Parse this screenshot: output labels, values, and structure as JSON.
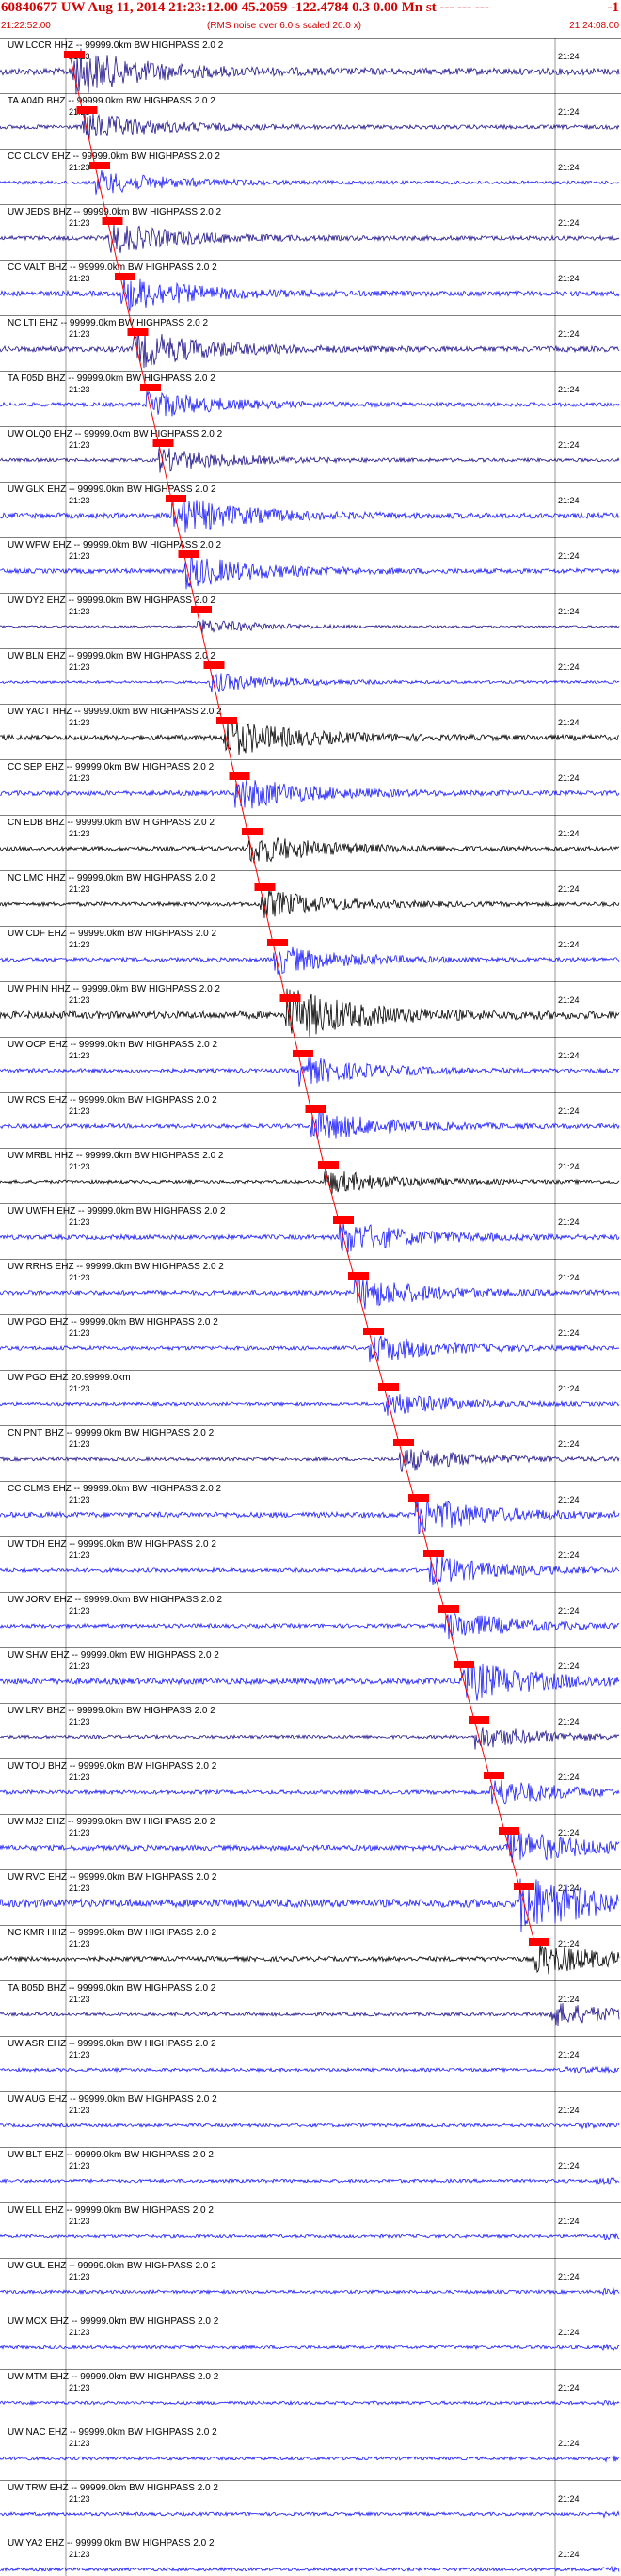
{
  "header": {
    "title": "60840677 UW Aug 11, 2014 21:23:12.00   45.2059  -122.4784  0.3 0.00 Mn st --- --- ---",
    "right_mark": "-1",
    "start_time": "21:22:52.00",
    "end_time": "21:24:08.00",
    "note": "(RMS noise over 6.0 s scaled 20.0 x)"
  },
  "chart_data": {
    "type": "line",
    "title": "60840677 UW Aug 11, 2014 21:23:12.00   45.2059  -122.4784  0.3 0.00 Mn st --- --- ---",
    "x_range": [
      "21:22:52.00",
      "21:24:08.00"
    ],
    "minute_ticks": [
      "21:23",
      "21:24"
    ],
    "colors": {
      "header": "#d40000",
      "pick": "#ff0000",
      "grid": "#000000"
    },
    "traces": [
      {
        "label": "UW LCCR HHZ -- 99999.0km BW  HIGHPASS  2.0  2",
        "color": "#20148c",
        "amp": 2.0
      },
      {
        "label": "TA A04D BHZ -- 99999.0km BW  HIGHPASS  2.0  2",
        "color": "#20148c",
        "amp": 1.2
      },
      {
        "label": "CC CLCV EHZ -- 99999.0km BW  HIGHPASS  2.0  2",
        "color": "#1a1aff",
        "amp": 1.0
      },
      {
        "label": "UW JEDS BHZ -- 99999.0km BW  HIGHPASS  2.0  2",
        "color": "#20148c",
        "amp": 1.3
      },
      {
        "label": "CC VALT BHZ -- 99999.0km BW  HIGHPASS  2.0  2",
        "color": "#1a1aff",
        "amp": 1.5
      },
      {
        "label": "NC LTI EHZ -- 99999.0km BW  HIGHPASS  2.0  2",
        "color": "#20148c",
        "amp": 1.6
      },
      {
        "label": "TA F05D BHZ -- 99999.0km BW  HIGHPASS  2.0  2",
        "color": "#1a1aff",
        "amp": 1.2
      },
      {
        "label": "UW OLQ0 EHZ -- 99999.0km BW  HIGHPASS  2.0  2",
        "color": "#20148c",
        "amp": 1.0
      },
      {
        "label": "UW GLK EHZ -- 99999.0km BW  HIGHPASS  2.0  2",
        "color": "#1a1aff",
        "amp": 1.6
      },
      {
        "label": "UW WPW EHZ -- 99999.0km BW  HIGHPASS  2.0  2",
        "color": "#1a1aff",
        "amp": 1.4
      },
      {
        "label": "UW DY2 EHZ -- 99999.0km BW  HIGHPASS  2.0  2",
        "color": "#20148c",
        "amp": 0.6
      },
      {
        "label": "UW BLN EHZ -- 99999.0km BW  HIGHPASS  2.0  2",
        "color": "#1a1aff",
        "amp": 0.8
      },
      {
        "label": "UW YACT HHZ -- 99999.0km BW  HIGHPASS  2.0  2",
        "color": "#000000",
        "amp": 1.6
      },
      {
        "label": "CC SEP EHZ -- 99999.0km BW  HIGHPASS  2.0  2",
        "color": "#1a1aff",
        "amp": 1.4
      },
      {
        "label": "CN EDB BHZ -- 99999.0km BW  HIGHPASS  2.0  2",
        "color": "#000000",
        "amp": 1.3
      },
      {
        "label": "NC LMC HHZ -- 99999.0km BW  HIGHPASS  2.0  2",
        "color": "#000000",
        "amp": 1.2
      },
      {
        "label": "UW CDF EHZ -- 99999.0km BW  HIGHPASS  2.0  2",
        "color": "#1a1aff",
        "amp": 1.2
      },
      {
        "label": "UW PHIN HHZ -- 99999.0km BW  HIGHPASS  2.0  2",
        "color": "#000000",
        "amp": 2.2
      },
      {
        "label": "UW OCP EHZ -- 99999.0km BW  HIGHPASS  2.0  2",
        "color": "#1a1aff",
        "amp": 1.2
      },
      {
        "label": "UW RCS EHZ -- 99999.0km BW  HIGHPASS  2.0  2",
        "color": "#1a1aff",
        "amp": 1.3
      },
      {
        "label": "UW MRBL HHZ -- 99999.0km BW  HIGHPASS  2.0  2",
        "color": "#000000",
        "amp": 1.0
      },
      {
        "label": "UW UWFH EHZ -- 99999.0km BW  HIGHPASS  2.0  2",
        "color": "#1a1aff",
        "amp": 1.4
      },
      {
        "label": "UW RRHS EHZ -- 99999.0km BW  HIGHPASS  2.0  2",
        "color": "#1a1aff",
        "amp": 1.4
      },
      {
        "label": "UW PGO EHZ -- 99999.0km BW  HIGHPASS  2.0  2",
        "color": "#1a1aff",
        "amp": 1.2
      },
      {
        "label": "UW PGO EHZ 20.99999.0km",
        "color": "#1a1aff",
        "amp": 1.0
      },
      {
        "label": "CN PNT BHZ -- 99999.0km BW  HIGHPASS  2.0  2",
        "color": "#20148c",
        "amp": 1.0
      },
      {
        "label": "CC CLMS EHZ -- 99999.0km BW  HIGHPASS  2.0  2",
        "color": "#1a1aff",
        "amp": 1.6
      },
      {
        "label": "UW TDH EHZ -- 99999.0km BW  HIGHPASS  2.0  2",
        "color": "#1a1aff",
        "amp": 1.2
      },
      {
        "label": "UW JORV EHZ -- 99999.0km BW  HIGHPASS  2.0  2",
        "color": "#1a1aff",
        "amp": 1.2
      },
      {
        "label": "UW SHW EHZ -- 99999.0km BW  HIGHPASS  2.0  2",
        "color": "#1a1aff",
        "amp": 1.8
      },
      {
        "label": "UW LRV BHZ -- 99999.0km BW  HIGHPASS  2.0  2",
        "color": "#20148c",
        "amp": 1.0
      },
      {
        "label": "UW TOU BHZ -- 99999.0km BW  HIGHPASS  2.0  2",
        "color": "#1a1aff",
        "amp": 1.2
      },
      {
        "label": "UW MJ2 EHZ -- 99999.0km BW  HIGHPASS  2.0  2",
        "color": "#1a1aff",
        "amp": 1.6
      },
      {
        "label": "UW RVC EHZ -- 99999.0km BW  HIGHPASS  2.0  2",
        "color": "#1a1aff",
        "amp": 2.4
      },
      {
        "label": "NC KMR HHZ -- 99999.0km BW  HIGHPASS  2.0  2",
        "color": "#000000",
        "amp": 1.4
      },
      {
        "label": "TA B05D BHZ -- 99999.0km BW  HIGHPASS  2.0  2",
        "color": "#20148c",
        "amp": 1.0
      },
      {
        "label": "UW ASR EHZ -- 99999.0km BW  HIGHPASS  2.0  2",
        "color": "#1a1aff",
        "amp": 1.0
      },
      {
        "label": "UW AUG EHZ -- 99999.0km BW  HIGHPASS  2.0  2",
        "color": "#1a1aff",
        "amp": 1.0
      },
      {
        "label": "UW BLT EHZ -- 99999.0km BW  HIGHPASS  2.0  2",
        "color": "#1a1aff",
        "amp": 1.0
      },
      {
        "label": "UW ELL EHZ -- 99999.0km BW  HIGHPASS  2.0  2",
        "color": "#1a1aff",
        "amp": 1.0
      },
      {
        "label": "UW GUL EHZ -- 99999.0km BW  HIGHPASS  2.0  2",
        "color": "#1a1aff",
        "amp": 1.0
      },
      {
        "label": "UW MOX EHZ -- 99999.0km BW  HIGHPASS  2.0  2",
        "color": "#1a1aff",
        "amp": 1.0
      },
      {
        "label": "UW MTM EHZ -- 99999.0km BW  HIGHPASS  2.0  2",
        "color": "#1a1aff",
        "amp": 1.0
      },
      {
        "label": "UW NAC EHZ -- 99999.0km BW  HIGHPASS  2.0  2",
        "color": "#1a1aff",
        "amp": 1.0
      },
      {
        "label": "UW TRW EHZ -- 99999.0km BW  HIGHPASS  2.0  2",
        "color": "#1a1aff",
        "amp": 1.0
      },
      {
        "label": "UW YA2 EHZ -- 99999.0km BW  HIGHPASS  2.0  2",
        "color": "#1a1aff",
        "amp": 1.0
      }
    ]
  }
}
